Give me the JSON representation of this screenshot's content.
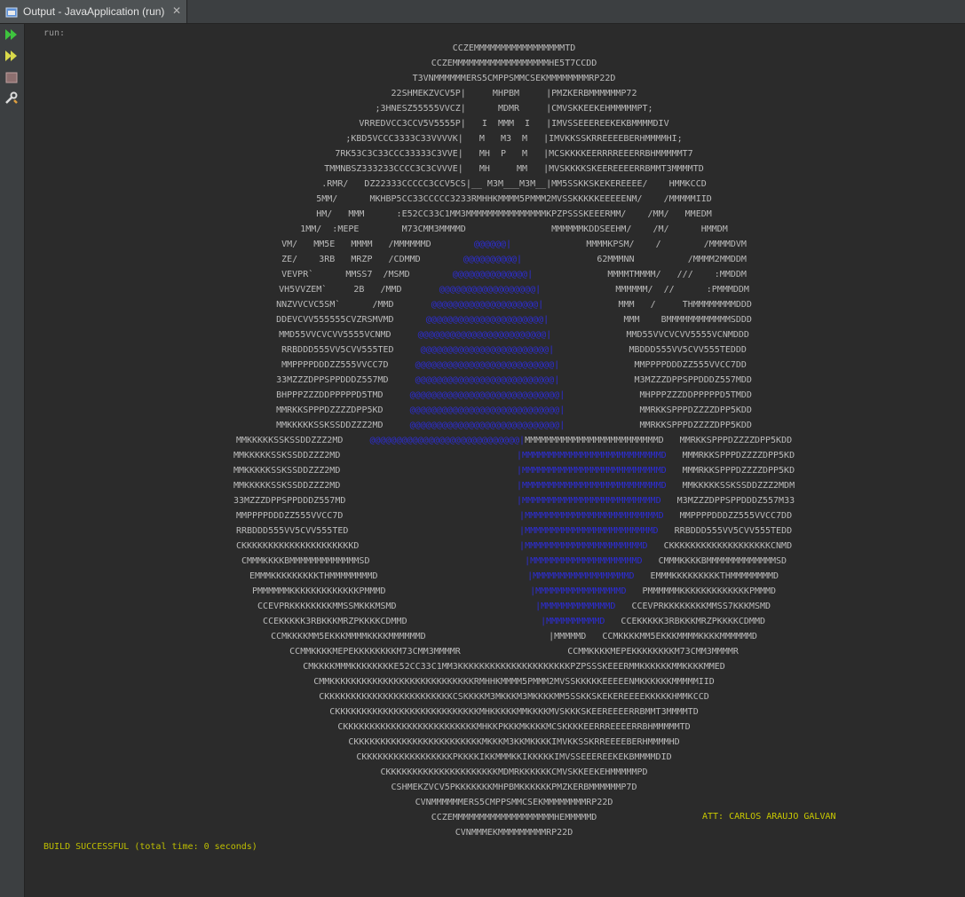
{
  "tab": {
    "title": "Output - JavaApplication (run)",
    "close": "✕"
  },
  "toolbar": {
    "rerun_icon": "rerun-icon",
    "rerun_options_icon": "rerun-with-options-icon",
    "stop_icon": "stop-icon",
    "settings_icon": "settings-icon"
  },
  "colors": {
    "background": "#2b2b2b",
    "text": "#bbbbbb",
    "blue": "#2d2dd6",
    "yellow": "#c9c900",
    "green": "#3ec43e"
  },
  "console": {
    "run_label": "run:",
    "art_lines": [
      "CCZEMMMMMMMMMMMMMMMMMTD",
      "CCZEMMMMMMMMMMMMMMMMMMHE5T7CCDD",
      "T3VNMMMMMMERS5CMPPSMMCSEKMMMMMMMMRP22D",
      "22SHMEKZVCV5P|     MHPBM     |PMZKERBMMMMMMP72",
      ";3HNESZ55555VVCZ|      MDMR     |CMVSKKEEKEHMMMMMPT;",
      "VRREDVCC3CCV5V5555P|   I  MMM  I   |IMVSSEEEREEKEKBMMMMDIV",
      ";KBD5VCCC3333C33VVVVK|   M   M3  M   |IMVKKSSKRREEEEBERHMMMMHI;",
      "7RK53C3C33CCC33333C3VVE|   MH  P   M   |MCSKKKKEERRRREEERRBHMMMMMT7",
      "TMMNBSZ333233CCCC3C3CVVVE|   MH     MM   |MVSKKKKSKEEREEEERRBMMT3MMMMTD",
      ".RMR/   DZ22333CCCCC3CCV5CS|__ M3M___M3M__|MM5SSKKSKEKEREEEE/    HMMKCCD",
      "5MM/      MKHBP5CC33CCCCC3233RMHHKMMMM5PMMM2MVSSKKKKKEEEEENM/    /MMMMMIID",
      "HM/   MMM      :E52CC33C1MM3MMMMMMMMMMMMMMMKPZPSSSKEEERMM/    /MM/   MMEDM",
      "1MM/  :MEPE        M73CMM3MMMMD                MMMMMMKDDSEEHM/    /M/      HMMDM",
      "VM/   MM5E   MMMM   /MMMMMMD        @@@@@@|              MMMMKPSM/    /        /MMMMDVM",
      "ZE/    3RB   MRZP   /CDMMD        @@@@@@@@@@|              62MMMNN          /MMMM2MMDDM",
      "VEVPR`      MMSS7  /MSMD        @@@@@@@@@@@@@@|              MMMMTMMMM/   ///    :MMDDM",
      "VH5VVZEM`     2B   /MMD       @@@@@@@@@@@@@@@@@@|              MMMMMM/  //      :PMMMDDM",
      "NNZVVCVC5SM`      /MMD       @@@@@@@@@@@@@@@@@@@@|              MMM   /     THMMMMMMMMDDD",
      "DDEVCVV555555CVZRSMVMD      @@@@@@@@@@@@@@@@@@@@@@|              MMM    BMMMMMMMMMMMMSDDD",
      "MMD55VVCVCVV5555VCNMD     @@@@@@@@@@@@@@@@@@@@@@@@|              MMD55VVCVCVV5555VCNMDDD",
      "RRBDDD555VV5CVV555TED     @@@@@@@@@@@@@@@@@@@@@@@@|              MBDDD555VV5CVV555TEDDD",
      "MMPPPPDDDZZ555VVCC7D     @@@@@@@@@@@@@@@@@@@@@@@@@@|              MMPPPPDDDZZ555VVCC7DD",
      "33MZZZDPPSPPDDDZ557MD     @@@@@@@@@@@@@@@@@@@@@@@@@@|              M3MZZZDPPSPPDDDZ557MDD",
      "BHPPPZZZDDPPPPPD5TMD     @@@@@@@@@@@@@@@@@@@@@@@@@@@@|              MHPPPZZZDDPPPPPD5TMDD",
      "MMRKKSPPPDZZZZDPP5KD     @@@@@@@@@@@@@@@@@@@@@@@@@@@@|              MMRKKSPPPDZZZZDPP5KDD",
      "MMKKKKKSSKSSDDZZZ2MD     @@@@@@@@@@@@@@@@@@@@@@@@@@@@|              MMRKKSPPPDZZZZDPP5KDD",
      "MMKKKKKSSKSSDDZZZ2MD     @@@@@@@@@@@@@@@@@@@@@@@@@@@@|MMMMMMMMMMMMMMMMMMMMMMMMMD   MMRKKSPPPDZZZZDPP5KDD",
      "MMKKKKKSSKSSDDZZZ2MD                                 |MMMMMMMMMMMMMMMMMMMMMMMMMMD   MMMRKKSPPPDZZZZDPP5KD",
      "MMKKKKKSSKSSDDZZZ2MD                                 |MMMMMMMMMMMMMMMMMMMMMMMMMMD   MMMRKKSPPPDZZZZDPP5KD",
      "MMKKKKKSSKSSDDZZZ2MD                                 |MMMMMMMMMMMMMMMMMMMMMMMMMMD   MMKKKKKSSKSSDDZZZ2MDM",
      "33MZZZDPPSPPDDDZ557MD                                |MMMMMMMMMMMMMMMMMMMMMMMMMD   M3MZZZDPPSPPDDDZ557M33",
      "MMPPPPDDDZZ555VVCC7D                                 |MMMMMMMMMMMMMMMMMMMMMMMMMD   MMPPPPDDDZZ555VVCC7DD",
      "RRBDDD555VV5CVV555TED                                |MMMMMMMMMMMMMMMMMMMMMMMMD   RRBDDD555VV5CVV555TEDD",
      "CKKKKKKKKKKKKKKKKKKKKKD                              |MMMMMMMMMMMMMMMMMMMMMMD   CKKKKKKKKKKKKKKKKKKKCNMD",
      "CMMMKKKKBMMMMMMMMMMMMMSD                             |MMMMMMMMMMMMMMMMMMMMD   CMMMKKKKBMMMMMMMMMMMMMSD",
      "EMMMKKKKKKKKKTHMMMMMMMMD                            |MMMMMMMMMMMMMMMMMMD   EMMMKKKKKKKKKTHMMMMMMMMD",
      "PMMMMMMKKKKKKKKKKKKKPMMMD                           |MMMMMMMMMMMMMMMMD   PMMMMMMKKKKKKKKKKKKKPMMMD",
      "CCEVPRKKKKKKKKMMSSMKKKMSMD                          |MMMMMMMMMMMMMD   CCEVPRKKKKKKKKMMSS7KKKMSMD",
      "CCEKKKKK3RBKKKMRZPKKKKCDMMD                         |MMMMMMMMMMD   CCEKKKKK3RBKKKMRZPKKKKCDMMD",
      "CCMKKKKMM5EKKKMMMMKKKKMMMMMMD                       |MMMMMD   CCMKKKKMM5EKKKMMMMKKKKMMMMMMD",
      "CCMMKKKKMEPEKKKKKKKKM73CMM3MMMMR                    CCMMKKKKMEPEKKKKKKKKM73CMM3MMMMR",
      "CMKKKKMMMKKKKKKKKE52CC33C1MM3KKKKKKKKKKKKKKKKKKKKKPZPSSSKEEERMMKKKKKKMMKKKKMMED",
      "CMMKKKKKKKKKKKKKKKKKKKKKKKKKKKRMHHKMMMM5PMMM2MVSSKKKKKEEEEENMKKKKKKMMMMMIID",
      "CKKKKKKKKKKKKKKKKKKKKKKKKCSKKKKM3MKKKM3MKKKKMM5SSKKSKEKEREEEEKKKKKHMMKCCD",
      "CKKKKKKKKKKKKKKKKKKKKKKKKKKKMHKKKKKMMKKKKMVSKKKSKEEREEEERRBMMT3MMMMTD",
      "CKKKKKKKKKKKKKKKKKKKKKKKKKMHKKPKKKMKKKKMCSKKKKEERRREEEERRBHMMMMMTD",
      "CKKKKKKKKKKKKKKKKKKKKKKKKMKKKM3KKMKKKKIMVKKSSKRREEEEBERHMMMMHD",
      "CKKKKKKKKKKKKKKKKKPKKKKIKKMMMKKIKKKKKIMVSSEEEREEKEKBMMMMDID",
      "CKKKKKKKKKKKKKKKKKKKKKMDMRKKKKKKCMVSKKEEKEHMMMMMPD",
      "CSHMEKZVCV5PKKKKKKKMHPBMKKKKKKPMZKERBMMMMMMP7D",
      "CVNMMMMMMERS5CMPPSMMCSEKMMMMMMMMRP22D",
      "CCZEMMMMMMMMMMMMMMMMMMMHEMMMMMD",
      "CVNMMMEKMMMMMMMMMRP22D"
    ],
    "attribution": "ATT: CARLOS ARAUJO GALVAN",
    "build_status": "BUILD SUCCESSFUL (total time: 0 seconds)"
  }
}
